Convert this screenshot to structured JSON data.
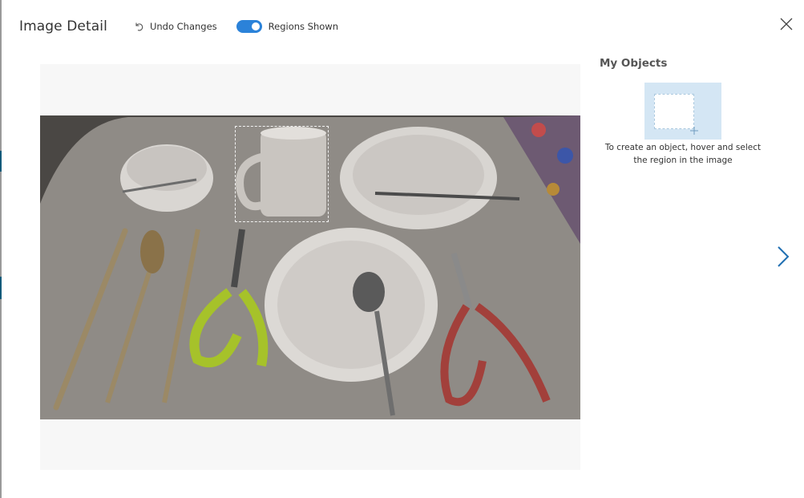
{
  "header": {
    "title": "Image Detail",
    "undo_label": "Undo Changes",
    "regions_toggle_label": "Regions Shown",
    "regions_toggle_on": true
  },
  "side_panel": {
    "title": "My Objects",
    "hint": "To create an object, hover and select the region in the image"
  },
  "icons": {
    "close": "close-icon",
    "undo": "undo-icon",
    "next": "chevron-right-icon",
    "add": "plus-icon"
  },
  "colors": {
    "accent": "#2b82d9",
    "card_bg": "#d4e6f4",
    "canvas_bg": "#f7f7f7"
  }
}
